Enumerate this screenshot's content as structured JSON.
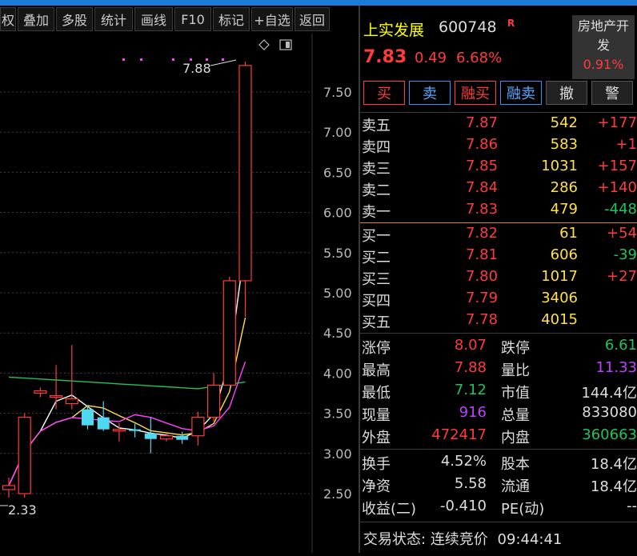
{
  "toolbar": {
    "buttons": [
      "权",
      "叠加",
      "多股",
      "统计",
      "画线",
      "F10",
      "标记",
      "+自选",
      "返回"
    ]
  },
  "chart": {
    "y_ticks": [
      "7.50",
      "7.00",
      "6.50",
      "6.00",
      "5.50",
      "5.00",
      "4.50",
      "4.00",
      "3.50",
      "3.00",
      "2.50"
    ],
    "high_label": "7.88",
    "low_label": "2.33",
    "colors": {
      "up": "#ff3b3b",
      "down": "#4fd8f0",
      "ma5": "#ffffff",
      "ma10": "#ffe04a",
      "ma20": "#ff40ff",
      "ma60": "#22c35a"
    }
  },
  "chart_data": {
    "type": "candlestick",
    "y_range": [
      2.2,
      8.0
    ],
    "candles": [
      {
        "o": 2.55,
        "h": 2.7,
        "l": 2.45,
        "c": 2.6
      },
      {
        "o": 2.5,
        "h": 3.5,
        "l": 2.45,
        "c": 3.45
      },
      {
        "o": 3.75,
        "h": 3.82,
        "l": 3.7,
        "c": 3.78
      },
      {
        "o": 3.7,
        "h": 4.1,
        "l": 3.55,
        "c": 3.72
      },
      {
        "o": 3.62,
        "h": 4.35,
        "l": 3.55,
        "c": 3.68
      },
      {
        "o": 3.55,
        "h": 3.6,
        "l": 3.3,
        "c": 3.35
      },
      {
        "o": 3.45,
        "h": 3.65,
        "l": 3.28,
        "c": 3.3
      },
      {
        "o": 3.28,
        "h": 3.38,
        "l": 3.15,
        "c": 3.3
      },
      {
        "o": 3.3,
        "h": 3.37,
        "l": 3.2,
        "c": 3.28
      },
      {
        "o": 3.25,
        "h": 3.45,
        "l": 3.0,
        "c": 3.18
      },
      {
        "o": 3.18,
        "h": 3.25,
        "l": 3.15,
        "c": 3.22
      },
      {
        "o": 3.22,
        "h": 3.27,
        "l": 3.12,
        "c": 3.17
      },
      {
        "o": 3.22,
        "h": 3.52,
        "l": 3.1,
        "c": 3.45
      },
      {
        "o": 3.45,
        "h": 4.0,
        "l": 3.4,
        "c": 3.85
      },
      {
        "o": 3.85,
        "h": 5.2,
        "l": 3.85,
        "c": 5.15
      },
      {
        "o": 5.15,
        "h": 7.88,
        "l": 4.7,
        "c": 7.83
      }
    ]
  },
  "quote": {
    "name": "上实发展",
    "code": "600748",
    "badge": "R",
    "price": "7.83",
    "change": "0.49",
    "change_pct": "6.68%",
    "sector_name": "房地产开发",
    "sector_pct": "0.91%"
  },
  "actions": [
    "买",
    "卖",
    "融买",
    "融卖",
    "撤",
    "警"
  ],
  "order_book": {
    "sell": [
      {
        "label": "卖五",
        "price": "7.87",
        "vol": "542",
        "delta": "+177"
      },
      {
        "label": "卖四",
        "price": "7.86",
        "vol": "583",
        "delta": "+1"
      },
      {
        "label": "卖三",
        "price": "7.85",
        "vol": "1031",
        "delta": "+157"
      },
      {
        "label": "卖二",
        "price": "7.84",
        "vol": "286",
        "delta": "+140"
      },
      {
        "label": "卖一",
        "price": "7.83",
        "vol": "479",
        "delta": "-448"
      }
    ],
    "buy": [
      {
        "label": "买一",
        "price": "7.82",
        "vol": "61",
        "delta": "+54"
      },
      {
        "label": "买二",
        "price": "7.81",
        "vol": "606",
        "delta": "-39"
      },
      {
        "label": "买三",
        "price": "7.80",
        "vol": "1017",
        "delta": "+27"
      },
      {
        "label": "买四",
        "price": "7.79",
        "vol": "3406",
        "delta": ""
      },
      {
        "label": "买五",
        "price": "7.78",
        "vol": "4015",
        "delta": ""
      }
    ]
  },
  "stats": {
    "limit_up_label": "涨停",
    "limit_up": "8.07",
    "limit_down_label": "跌停",
    "limit_down": "6.61",
    "high_label": "最高",
    "high": "7.88",
    "vol_ratio_label": "量比",
    "vol_ratio": "11.33",
    "low_label": "最低",
    "low": "7.12",
    "mkt_cap_label": "市值",
    "mkt_cap": "144.4亿",
    "cur_vol_label": "现量",
    "cur_vol": "916",
    "total_vol_label": "总量",
    "total_vol": "833080",
    "outer_label": "外盘",
    "outer": "472417",
    "inner_label": "内盘",
    "inner": "360663",
    "turnover_label": "换手",
    "turnover": "4.52%",
    "capital_label": "股本",
    "capital": "18.4亿",
    "nav_label": "净资",
    "nav": "5.58",
    "float_label": "流通",
    "float": "18.4亿",
    "eps_label": "收益(二)",
    "eps": "-0.410",
    "pe_label": "PE(动)",
    "pe": "--"
  },
  "status": {
    "label": "交易状态:",
    "state": "连续竞价",
    "time": "09:44:41"
  }
}
